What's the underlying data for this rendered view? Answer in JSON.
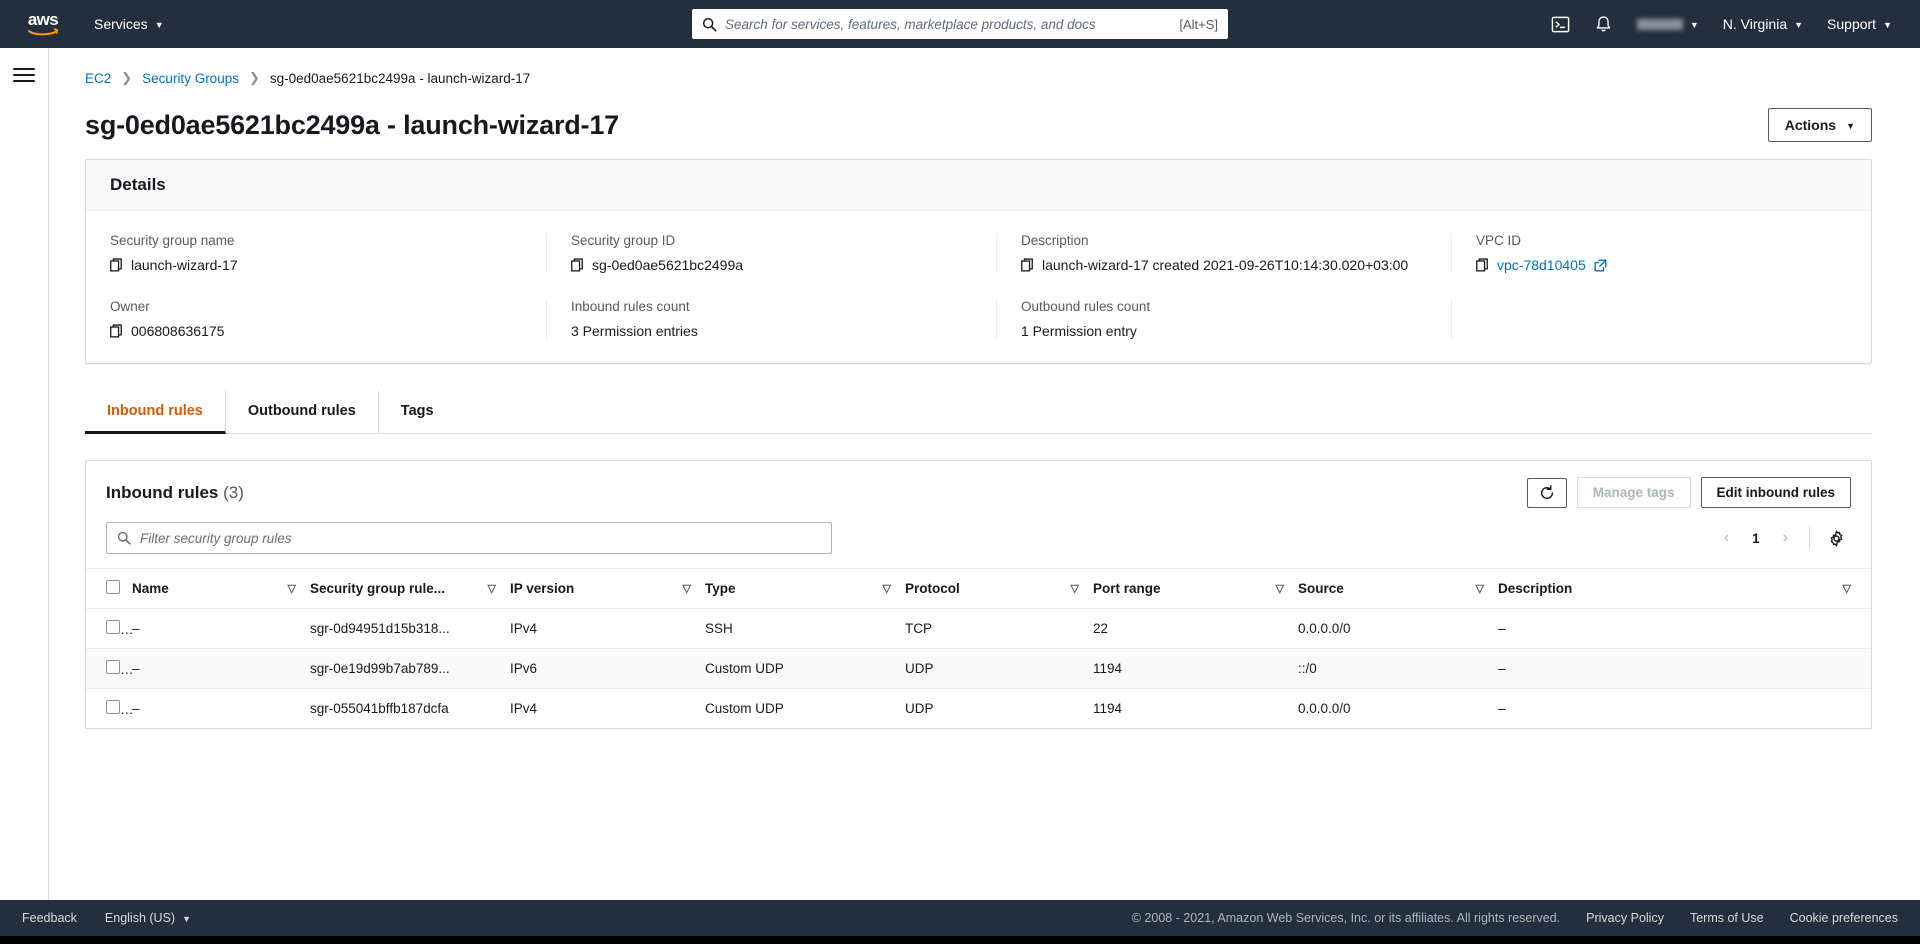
{
  "topnav": {
    "logo_text": "aws",
    "services_label": "Services",
    "search": {
      "placeholder": "Search for services, features, marketplace products, and docs",
      "value": "",
      "shortcut": "[Alt+S]"
    },
    "cloudshell_icon": "cloudshell-icon",
    "bell_icon": "bell-icon",
    "account_label": "",
    "region_label": "N. Virginia",
    "support_label": "Support"
  },
  "breadcrumb": {
    "items": [
      {
        "label": "EC2",
        "link": true
      },
      {
        "label": "Security Groups",
        "link": true
      },
      {
        "label": "sg-0ed0ae5621bc2499a - launch-wizard-17",
        "link": false
      }
    ],
    "separator": "›"
  },
  "page": {
    "title": "sg-0ed0ae5621bc2499a - launch-wizard-17",
    "actions_label": "Actions"
  },
  "details": {
    "heading": "Details",
    "fields": [
      {
        "label": "Security group name",
        "value": "launch-wizard-17",
        "copyable": true
      },
      {
        "label": "Security group ID",
        "value": "sg-0ed0ae5621bc2499a",
        "copyable": true
      },
      {
        "label": "Description",
        "value": "launch-wizard-17 created 2021-09-26T10:14:30.020+03:00",
        "copyable": true
      },
      {
        "label": "VPC ID",
        "value": "vpc-78d10405",
        "copyable": true,
        "link": true
      },
      {
        "label": "Owner",
        "value": "006808636175",
        "copyable": true
      },
      {
        "label": "Inbound rules count",
        "value": "3 Permission entries",
        "copyable": false
      },
      {
        "label": "Outbound rules count",
        "value": "1 Permission entry",
        "copyable": false
      }
    ]
  },
  "tabs": [
    {
      "label": "Inbound rules",
      "active": true
    },
    {
      "label": "Outbound rules",
      "active": false
    },
    {
      "label": "Tags",
      "active": false
    }
  ],
  "rules_panel": {
    "title": "Inbound rules",
    "count": "(3)",
    "refresh_icon": "refresh-icon",
    "manage_tags_label": "Manage tags",
    "edit_rules_label": "Edit inbound rules",
    "filter_placeholder": "Filter security group rules",
    "filter_value": "",
    "pagination": {
      "prev": "‹",
      "page": "1",
      "next": "›"
    },
    "settings_icon": "gear-icon",
    "columns": [
      "Name",
      "Security group rule...",
      "IP version",
      "Type",
      "Protocol",
      "Port range",
      "Source",
      "Description"
    ],
    "rows": [
      {
        "name": "–",
        "rule_id": "sgr-0d94951d15b318...",
        "ip_version": "IPv4",
        "type": "SSH",
        "protocol": "TCP",
        "port_range": "22",
        "source": "0.0.0.0/0",
        "description": "–"
      },
      {
        "name": "–",
        "rule_id": "sgr-0e19d99b7ab789...",
        "ip_version": "IPv6",
        "type": "Custom UDP",
        "protocol": "UDP",
        "port_range": "1194",
        "source": "::/0",
        "description": "–"
      },
      {
        "name": "–",
        "rule_id": "sgr-055041bffb187dcfa",
        "ip_version": "IPv4",
        "type": "Custom UDP",
        "protocol": "UDP",
        "port_range": "1194",
        "source": "0.0.0.0/0",
        "description": "–"
      }
    ]
  },
  "footer": {
    "feedback_label": "Feedback",
    "language_label": "English (US)",
    "copyright": "© 2008 - 2021, Amazon Web Services, Inc. or its affiliates. All rights reserved.",
    "links": [
      "Privacy Policy",
      "Terms of Use",
      "Cookie preferences"
    ]
  },
  "colors": {
    "nav_bg": "#232f3e",
    "link": "#0073bb",
    "active_tab": "#d45b07",
    "border": "#d5dbdb"
  }
}
